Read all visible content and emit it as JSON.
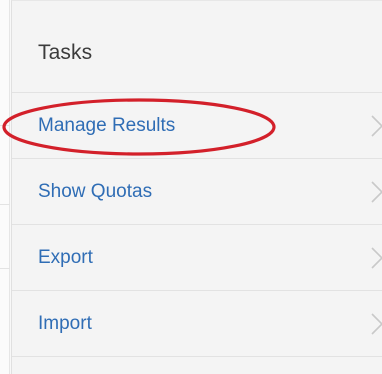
{
  "panel": {
    "title": "Tasks"
  },
  "tasks": [
    {
      "label": "Manage Results",
      "icon": "chevron-right-icon"
    },
    {
      "label": "Show Quotas",
      "icon": "chevron-right-icon"
    },
    {
      "label": "Export",
      "icon": "chevron-right-icon"
    },
    {
      "label": "Import",
      "icon": "chevron-right-icon"
    }
  ],
  "colors": {
    "link": "#2f6db5",
    "title": "#3b3b3b",
    "annotation": "#d3202a",
    "chevron": "#c9c9c9"
  }
}
